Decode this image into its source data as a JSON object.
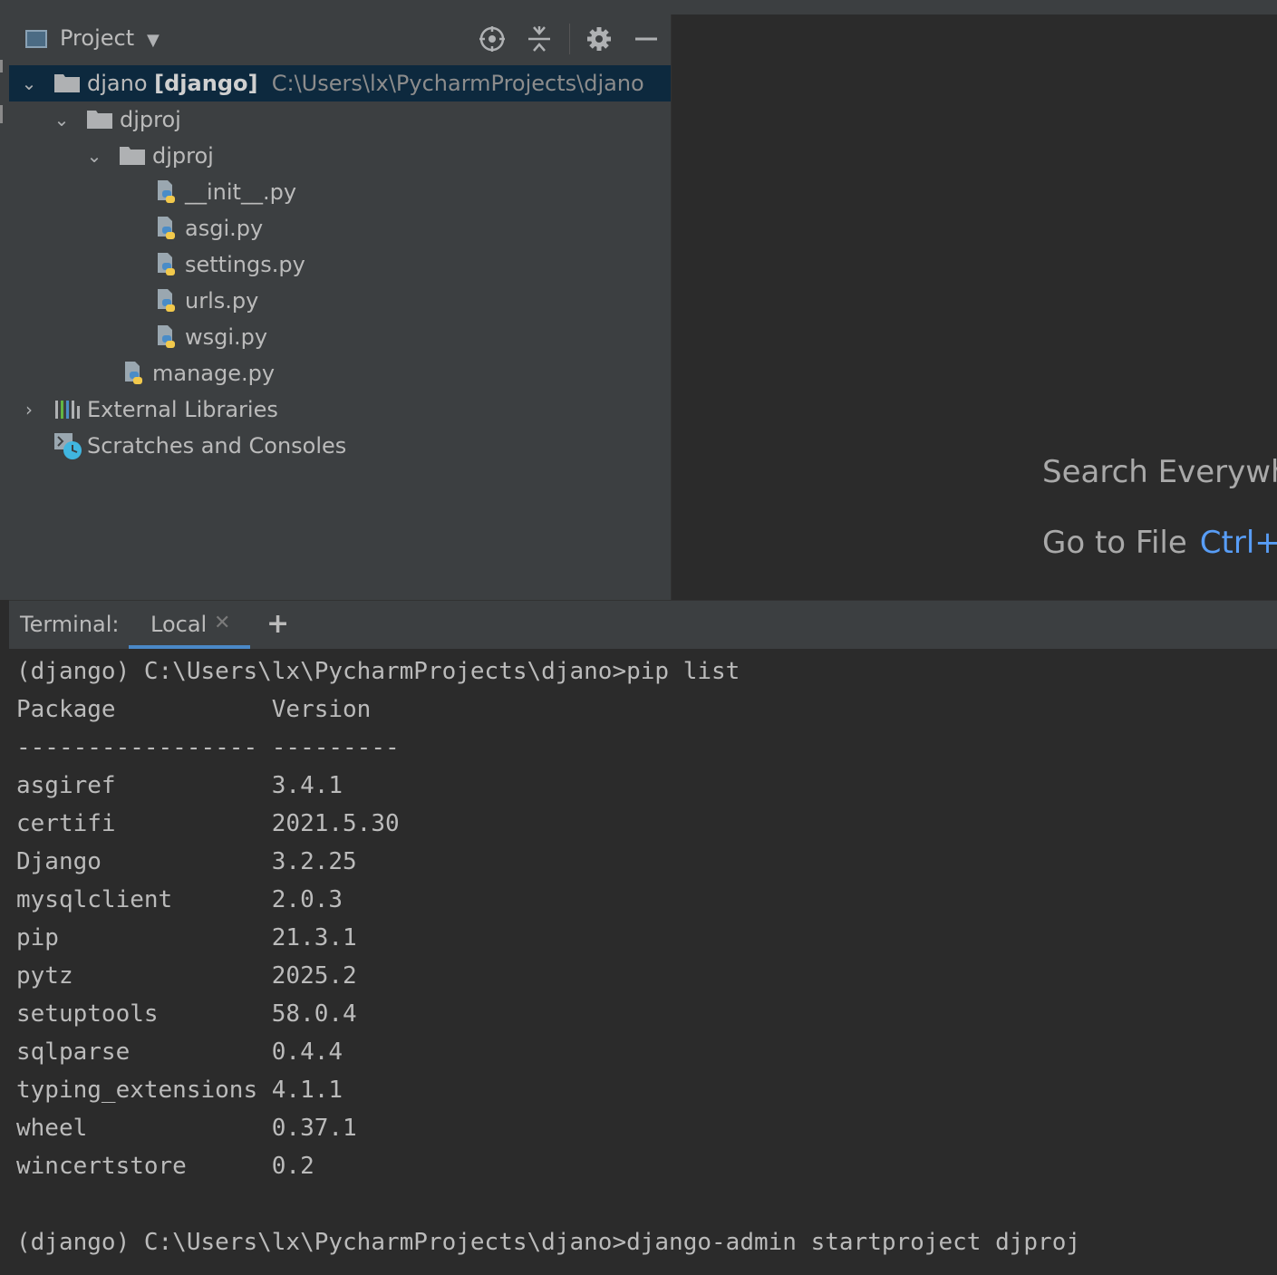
{
  "project": {
    "title": "Project",
    "tree": {
      "root_name": "djano",
      "root_env": "[django]",
      "root_path": "C:\\Users\\lx\\PycharmProjects\\djano",
      "folder1": "djproj",
      "folder2": "djproj",
      "files": [
        "__init__.py",
        "asgi.py",
        "settings.py",
        "urls.py",
        "wsgi.py"
      ],
      "manage": "manage.py",
      "external": "External Libraries",
      "scratches": "Scratches and Consoles"
    }
  },
  "editor": {
    "search_hint": "Search Everywhe",
    "goto_hint": "Go to File",
    "goto_key": "Ctrl+S"
  },
  "terminal": {
    "label": "Terminal:",
    "tab": "Local",
    "cmd1": "(django) C:\\Users\\lx\\PycharmProjects\\djano>pip list",
    "header": "Package           Version",
    "divider": "----------------- ---------",
    "packages": [
      "asgiref           3.4.1",
      "certifi           2021.5.30",
      "Django            3.2.25",
      "mysqlclient       2.0.3",
      "pip               21.3.1",
      "pytz              2025.2",
      "setuptools        58.0.4",
      "sqlparse          0.4.4",
      "typing_extensions 4.1.1",
      "wheel             0.37.1",
      "wincertstore      0.2"
    ],
    "cmd2": "(django) C:\\Users\\lx\\PycharmProjects\\djano>django-admin startproject djproj"
  }
}
